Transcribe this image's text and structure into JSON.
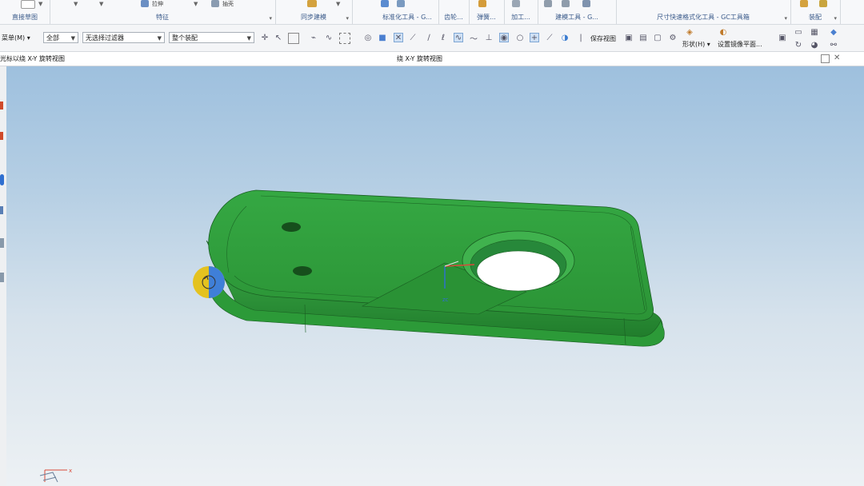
{
  "ribbon": {
    "groups": [
      {
        "label": "直接草图"
      },
      {
        "label": "特征"
      },
      {
        "label": "同步建模"
      },
      {
        "label": "标准化工具 - G..."
      },
      {
        "label": "齿轮..."
      },
      {
        "label": "弹簧..."
      },
      {
        "label": "加工..."
      },
      {
        "label": "建模工具 - G..."
      },
      {
        "label": "尺寸快速格式化工具 - GC工具箱"
      },
      {
        "label": "装配"
      }
    ],
    "top_labels": {
      "extrude": "拉伸",
      "shell": "抽壳"
    }
  },
  "toolbar": {
    "menu_label": "菜单(M)",
    "filter_all": "全部",
    "filter_none": "无选择过滤器",
    "scope": "整个装配",
    "save_view": "保存视图",
    "shape_label": "形状(H)",
    "mirror_plane": "设置镜像平面..."
  },
  "view": {
    "left_title": "光标以绕 X-Y 旋转视图",
    "center_title": "绕 X-Y 旋转视图"
  },
  "viewport": {
    "triad_x": "x",
    "colors": {
      "part": "#2e9a3a",
      "part_dark": "#1d6f27",
      "accent": "#3f7fd8",
      "cursor": "#e4c21f"
    }
  }
}
